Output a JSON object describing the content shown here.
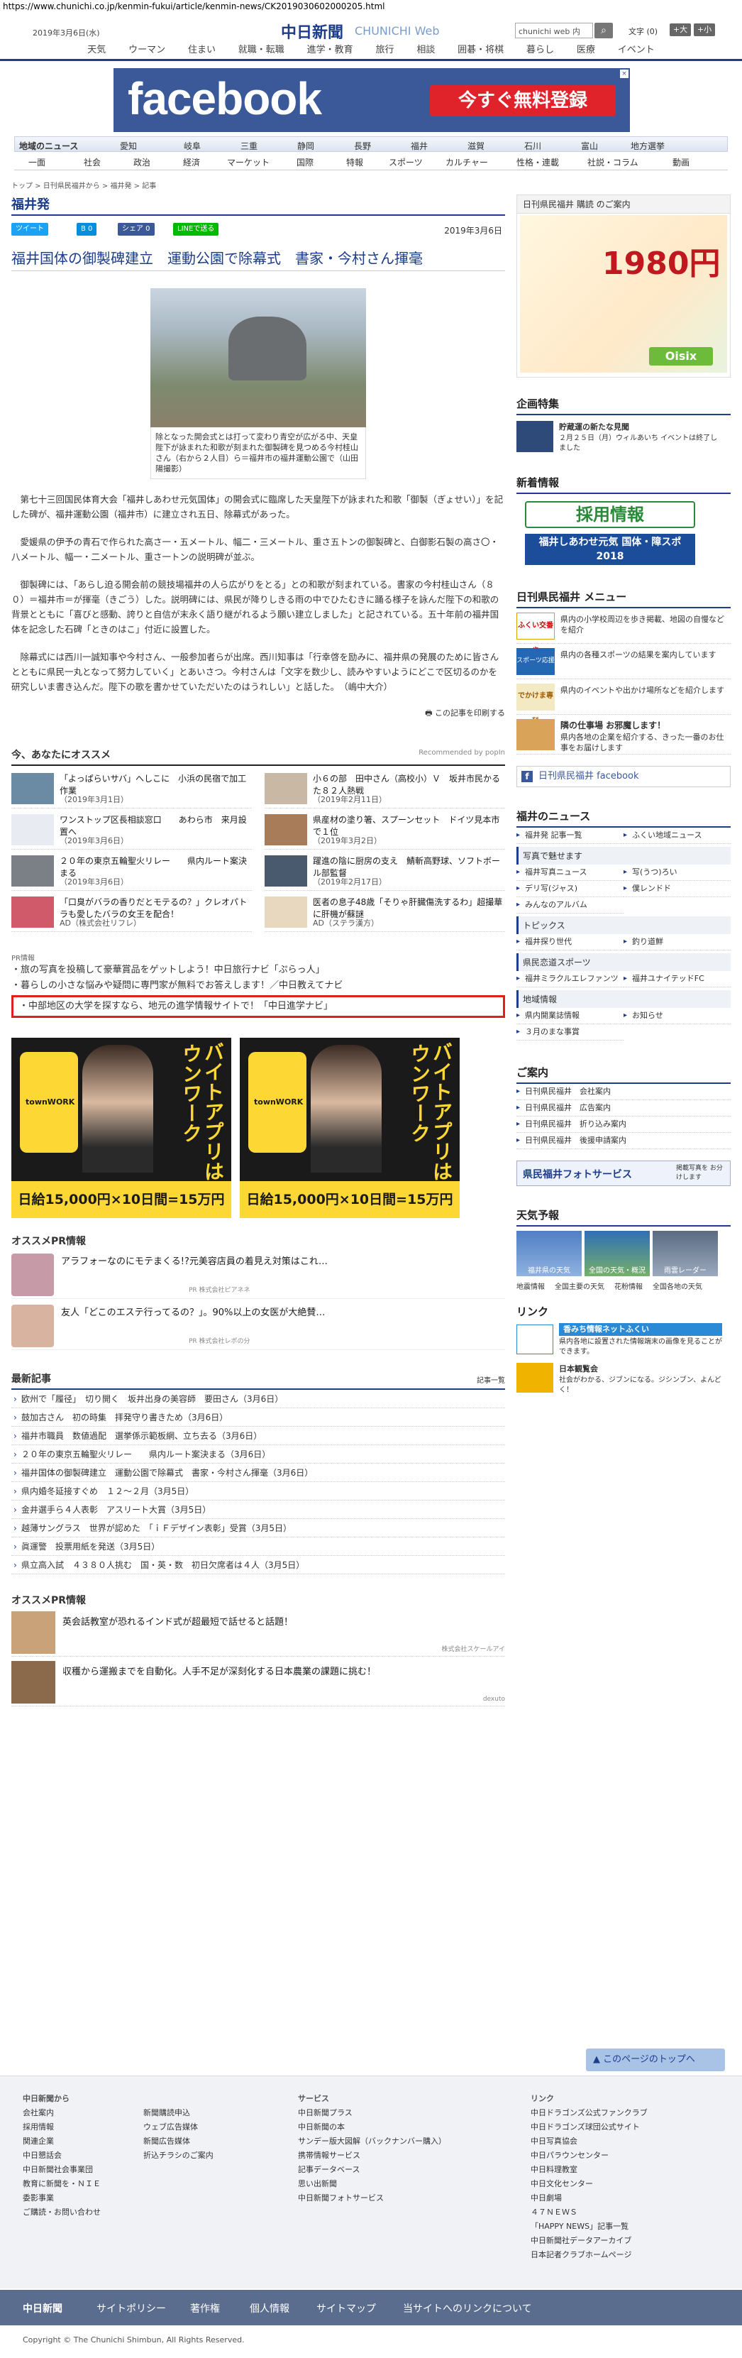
{
  "url": "https://www.chunichi.co.jp/kenmin-fukui/article/kenmin-news/CK2019030602000205.html",
  "header": {
    "date": "2019年3月6日(水)",
    "logo": "中日新聞",
    "logo_web": "CHUNICHI Web",
    "search_placeholder": "chunichi web 内",
    "font_label": "文字 (0)",
    "font_big": "+大",
    "font_small": "+小"
  },
  "global_nav": [
    "天気",
    "ウーマン",
    "住まい",
    "就職・転職",
    "進学・教育",
    "旅行",
    "相談",
    "囲碁・将棋",
    "暮らし",
    "医療",
    "イベント"
  ],
  "top_ad": {
    "brand": "facebook",
    "cta": "今すぐ無料登録"
  },
  "region_nav": [
    "地域のニュース",
    "愛知",
    "岐阜",
    "三重",
    "静岡",
    "長野",
    "福井",
    "滋賀",
    "石川",
    "富山",
    "地方選挙"
  ],
  "category_nav": [
    "一面",
    "社会",
    "政治",
    "経済",
    "マーケット",
    "国際",
    "特報",
    "スポーツ",
    "カルチャー",
    "性格・連載",
    "社説・コラム",
    "動画"
  ],
  "breadcrumb": "トップ > 日刊県民福井から > 福井発 > 記事",
  "section_title": "福井発",
  "share": {
    "tweet": "ツイート",
    "hatena": "B 0",
    "fb": "シェア 0",
    "line": "LINEで送る"
  },
  "article": {
    "pub_date": "2019年3月6日",
    "title": "福井国体の御製碑建立　運動公園で除幕式　書家・今村さん揮毫",
    "photo_caption": "除となった開会式とは打って変わり青空が広がる中、天皇陛下が詠まれた和歌が刻まれた御製碑を見つめる今村桂山さん（右から２人目）ら＝福井市の福井運動公園で（山田陽撮影）",
    "paragraphs": [
      "第七十三回国民体育大会「福井しあわせ元気国体」の開会式に臨席した天皇陛下が詠まれた和歌「御製（ぎょせい）」を記した碑が、福井運動公園（福井市）に建立され五日、除幕式があった。",
      "愛媛県の伊予の青石で作られた高さ一・五メートル、幅二・三メートル、重さ五トンの御製碑と、白御影石製の高さ〇・八メートル、幅一・二メートル、重さ一トンの説明碑が並ぶ。",
      "御製碑には、「あらし迫る開会前の競技場福井の人ら広がりをとる」との和歌が刻まれている。書家の今村桂山さん（８０）＝福井市＝が揮毫（きごう）した。説明碑には、県民が降りしきる雨の中でひたむきに踊る様子を詠んだ陛下の和歌の背景とともに「喜びと感動、誇りと自信が末永く語り継がれるよう願い建立しました」と記されている。五十年前の福井国体を記念した石碑「ときのはこ」付近に設置した。",
      "除幕式には西川一誠知事や今村さん、一般参加者らが出席。西川知事は「行幸啓を励みに、福井県の発展のために皆さんとともに県民一丸となって努力していく」とあいさつ。今村さんは「文字を数少し、読みやすいようにどこで区切るのかを研究しいま書き込んだ。陛下の歌を書かせていただいたのはうれしい」と話した。　（嶋中大介）"
    ],
    "print": "この記事を印刷する"
  },
  "recommend": {
    "title": "今、あなたにオススメ",
    "by": "Recommended by popIn",
    "items": [
      {
        "text": "「よっぱらいサバ」へしこに　小浜の民宿で加工作業",
        "date": "（2019年3月1日）"
      },
      {
        "text": "小６の部　田中さん（高校小）Ｖ　坂井市民かるた８２人熱戦",
        "date": "（2019年2月11日）"
      },
      {
        "text": "ワンストップ区長相談窓口　　あわら市　来月設置へ",
        "date": "（2019年3月6日）"
      },
      {
        "text": "県産材の塗り箸、スプーンセット　ドイツ見本市で１位",
        "date": "（2019年3月2日）"
      },
      {
        "text": "２０年の東京五輪聖火リレー　　県内ルート案決まる",
        "date": "（2019年3月6日）"
      },
      {
        "text": "躍進の陰に厨房の支え　鯖斬高野球、ソフトボール部監督",
        "date": "（2019年2月17日）"
      },
      {
        "text": "「口臭がバラの香りだとモテるの？」クレオパトラも愛したバラの女王を配合！",
        "date": "AD（株式会社リフレ）"
      },
      {
        "text": "医者の息子48歳「そりゃ肝臓傷洗するわ」超撮華に肝機が蘇謎",
        "date": "AD（ステラ漢方）"
      }
    ]
  },
  "pr": {
    "label": "PR情報",
    "items": [
      "旅の写真を投稿して豪華賞品をゲットしよう！中日旅行ナビ「ぷらっ人」",
      "暮らしの小さな悩みや疑問に専門家が無料でお答えします！／中日教えてナビ",
      "中部地区の大学を探すなら、地元の進学情報サイトで！「中日進学ナビ」"
    ]
  },
  "banners": [
    {
      "vertical": "バイトアプリはタウンワーク",
      "pay": "日給15,000円×10日間=15万円",
      "brand": "townWORK"
    },
    {
      "vertical": "バイトアプリはタウンワーク",
      "pay": "日給15,000円×10日間=15万円",
      "brand": "townWORK"
    }
  ],
  "pr2": {
    "title": "オススメPR情報",
    "items": [
      {
        "text": "アラフォーなのにモテまくる!?元美容店員の着見え対策はこれ…",
        "sponsor": "PR 株式会社ピアネネ"
      },
      {
        "text": "友人「どこのエステ行ってるの？」。90%以上の女医が大絶賛…",
        "sponsor": "PR 株式会社レポの分"
      }
    ]
  },
  "latest": {
    "title": "最新記事",
    "more": "記事一覧",
    "items": [
      "欧州で「履径」　切り開く　坂井出身の美容師　要田さん（3月6日）",
      "鼓加古さん　初の時集　拝発守り書きため（3月6日）",
      "福井市職員　数値過配　選挙係示範板網、立ち去る（3月6日）",
      "２０年の東京五輪聖火リレー　　県内ルート案決まる（3月6日）",
      "福井国体の御製碑建立　運動公園で除幕式　書家・今村さん揮毫（3月6日）",
      "県内婚冬延接すぐめ　１２～２月（3月5日）",
      "金井選手ら４人表彰　アスリート大賞（3月5日）",
      "越薄サングラス　世界が認めた　「ｉＦデザイン表彰」受賞（3月5日）",
      "眞運警　投票用紙を発送（3月5日）",
      "県立高入試　４３８０人挑む　国・英・数　初日欠席者は４人（3月5日）"
    ]
  },
  "pr3": {
    "title": "オススメPR情報",
    "items": [
      {
        "text": "英会話教室が恐れるインド式が超最短で話せると話題！",
        "sponsor": "株式会社スケールアイ"
      },
      {
        "text": "収穫から運搬までを自動化。人手不足が深刻化する日本農業の課題に挑む！",
        "sponsor": "dexuto"
      }
    ]
  },
  "side": {
    "ad_head": "日刊県民福井 購読 のご案内",
    "ad_price": "1980円",
    "ad_brand": "Oisix",
    "feature_title": "企画特集",
    "feature_item": "貯蔵運の新たな見聞",
    "feature_sub": "２月２５日（月）ウィルあいち イベントは終了しました",
    "new_title": "新着情報",
    "saiyo": "採用情報",
    "kokutai": "福井しあわせ元気 国体・障スポ 2018",
    "menu_title": "日刊県民福井 メニュー",
    "menu": [
      {
        "h": "ふくい交番歩",
        "t": "県内の小学校周辺を歩き掲載、地図の自慢などを紹介"
      },
      {
        "h": "スポーツ応援隊",
        "t": "県内の各種スポーツの結果を案内しています"
      },
      {
        "h": "でかけま専科",
        "t": "県内のイベントや出かけ場所などを紹介します"
      },
      {
        "h": "隣の仕事場 お邪魔します！",
        "t": "県内各地の企業を紹介する、きった一番のお仕事をお届けします"
      }
    ],
    "fb_title": "日刊県民福井 facebook",
    "news_title": "福井のニュース",
    "news_links": [
      "福井発 記事一覧",
      "ふくい地域ニュース"
    ],
    "photo_title": "写真で魅せます",
    "photo_links": [
      "福井写真ニュース",
      "写(うつ)ろい",
      "デリ写(ジャス)",
      "僕レンドド",
      "みんなのアルバム"
    ],
    "topics_title": "トピックス",
    "topics_links": [
      "福井探り世代",
      "釣り道鮮"
    ],
    "sports_title": "県民恋道スポーツ",
    "sports_links": [
      "福井ミラクルエレファンツ",
      "福井ユナイテッドFC"
    ],
    "area_title": "地域情報",
    "area_links": [
      "県内開業誌情報",
      "お知らせ",
      "３月のまな事賞"
    ],
    "guide_title": "ご案内",
    "guide_links": [
      "日刊県民福井　会社案内",
      "日刊県民福井　広告案内",
      "日刊県民福井　折り込み案内",
      "日刊県民福井　後援申請案内"
    ],
    "photo_service": "県民福井フォトサービス",
    "photo_service_sub": "掲載写真を お分けします",
    "weather_title": "天気予報",
    "weather_labels": [
      "福井県の天気",
      "全国の天気・概況",
      "雨雲レーダー"
    ],
    "weather_links": [
      "地震情報",
      "全国主要の天気",
      "花粉情報",
      "全国各地の天気"
    ],
    "link_title": "リンク",
    "link1": "香みち情報ネットふくい",
    "link1_sub": "県内各地に設置された情報端末の画像を見ることができます。",
    "link2": "日本観覧会",
    "link2_sub": "社会がわかる、ジブンになる。ジシンブン、よんどく！"
  },
  "totop": "このページのトップへ",
  "footer": {
    "col1": [
      "中日新聞から",
      "会社案内",
      "採用情報",
      "関連企業",
      "中日懇話会",
      "中日新聞社会事業団",
      "教育に新聞を・ＮＩＥ",
      "委影事業",
      "ご購読・お問い合わせ"
    ],
    "col2": [
      "",
      "新聞購読申込",
      "ウェブ広告媒体",
      "新聞広告媒体",
      "折込チラシのご案内"
    ],
    "col3": [
      "サービス",
      "中日新聞プラス",
      "中日新聞の本",
      "サンデー版大図解（バックナンバー購入）",
      "携帯情報サービス",
      "記事データベース",
      "思い出新聞",
      "中日新聞フォトサービス"
    ],
    "col4": [
      "リンク",
      "中日ドラゴンズ公式ファンクラブ",
      "中日ドラゴンズ球団公式サイト",
      "中日写真協会",
      "中日パラウンセンター",
      "中日料理教室",
      "中日文化センター",
      "中日劇場",
      "４７ＮＥＷＳ",
      "「HAPPY NEWS」記事一覧",
      "中日新聞社データアーカイブ",
      "日本記者クラブホームページ"
    ]
  },
  "footer_bar": [
    "中日新聞",
    "サイトポリシー",
    "著作権",
    "個人情報",
    "サイトマップ",
    "当サイトへのリンクについて"
  ],
  "copyright": "Copyright © The Chunichi Shimbun, All Rights Reserved."
}
